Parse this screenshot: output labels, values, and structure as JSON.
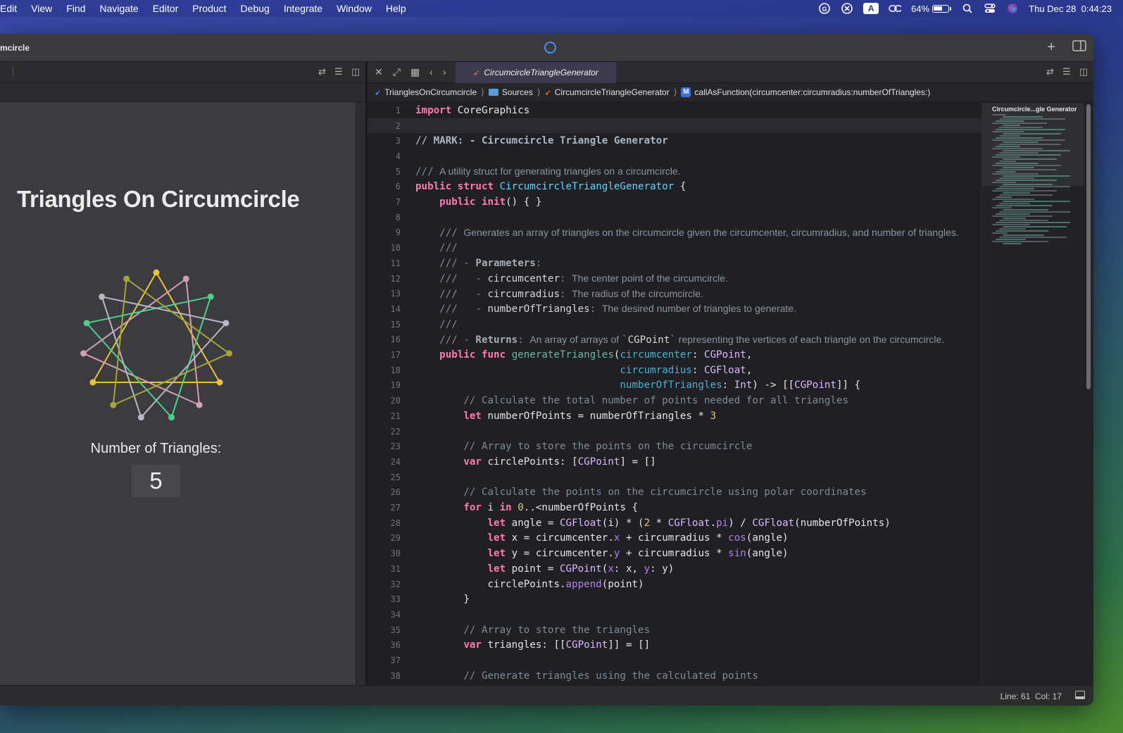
{
  "menubar": {
    "items": [
      "Edit",
      "View",
      "Find",
      "Navigate",
      "Editor",
      "Product",
      "Debug",
      "Integrate",
      "Window",
      "Help"
    ],
    "status": {
      "battery": "64%",
      "datetime": "Thu Dec 28  0:44:23",
      "input_source": "A"
    }
  },
  "window": {
    "title": "mcircle"
  },
  "preview": {
    "title": "Triangles On Circumcircle",
    "label": "Number of Triangles:",
    "count": "5",
    "triangle_colors": [
      "#e8c33a",
      "#d4a0b0",
      "#4ccf8a",
      "#b7b7c7",
      "#a7a53a"
    ]
  },
  "editor": {
    "tab": "CircumcircleTriangleGenerator",
    "breadcrumb": {
      "project": "TrianglesOnCircumcircle",
      "folder": "Sources",
      "file": "CircumcircleTriangleGenerator",
      "badge": "M",
      "symbol": "callAsFunction(circumcenter:circumradius:numberOfTriangles:)"
    },
    "line_numbers": [
      "1",
      "2",
      "3",
      "4",
      "5",
      "6",
      "7",
      "8",
      "9",
      "10",
      "11",
      "12",
      "13",
      "14",
      "15",
      "16",
      "17",
      "18",
      "19",
      "20",
      "21",
      "22",
      "23",
      "24",
      "25",
      "26",
      "27",
      "28",
      "29",
      "30",
      "31",
      "32",
      "33",
      "34",
      "35",
      "36",
      "37",
      "38"
    ],
    "minimap_title": "Circumcircle...gle Generator",
    "cursor_position": "Line: 61  Col: 17"
  }
}
